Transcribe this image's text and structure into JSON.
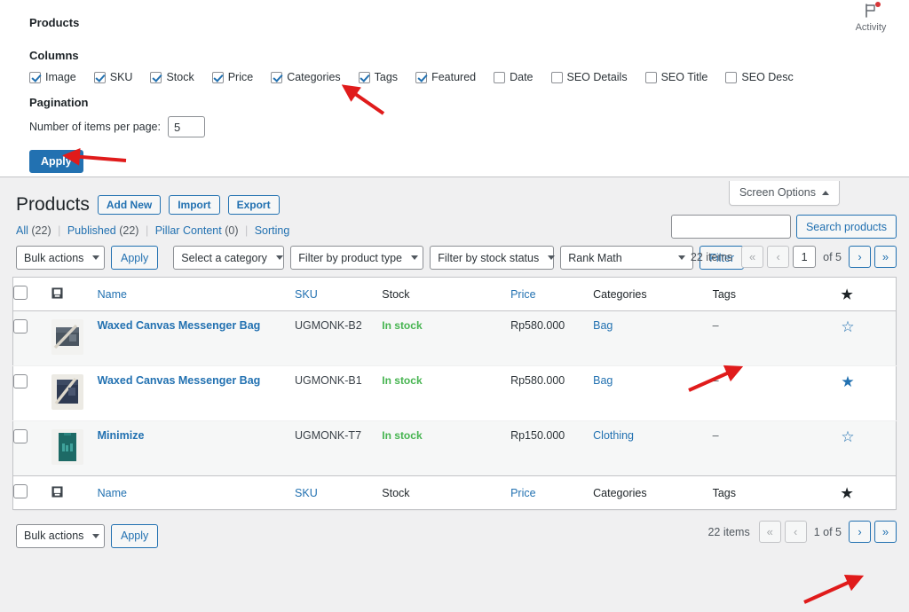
{
  "screen_options": {
    "title": "Products",
    "activity": {
      "label": "Activity",
      "icon": "flag-icon",
      "badge_color": "#d63638"
    },
    "columns_label": "Columns",
    "columns": [
      {
        "label": "Image",
        "checked": true
      },
      {
        "label": "SKU",
        "checked": true
      },
      {
        "label": "Stock",
        "checked": true
      },
      {
        "label": "Price",
        "checked": true
      },
      {
        "label": "Categories",
        "checked": true
      },
      {
        "label": "Tags",
        "checked": true
      },
      {
        "label": "Featured",
        "checked": true
      },
      {
        "label": "Date",
        "checked": false
      },
      {
        "label": "SEO Details",
        "checked": false
      },
      {
        "label": "SEO Title",
        "checked": false
      },
      {
        "label": "SEO Desc",
        "checked": false
      }
    ],
    "pagination_label": "Pagination",
    "items_per_page_label": "Number of items per page:",
    "items_per_page_value": "5",
    "apply_label": "Apply"
  },
  "screen_options_tab": {
    "label": "Screen Options",
    "icon": "caret-up-icon"
  },
  "header": {
    "title": "Products",
    "buttons": [
      {
        "label": "Add New"
      },
      {
        "label": "Import"
      },
      {
        "label": "Export"
      }
    ]
  },
  "search": {
    "value": "",
    "placeholder": "",
    "button_label": "Search products"
  },
  "views": [
    {
      "label": "All",
      "count": "(22)"
    },
    {
      "label": "Published",
      "count": "(22)"
    },
    {
      "label": "Pillar Content",
      "count": "(0)"
    },
    {
      "label": "Sorting",
      "count": ""
    }
  ],
  "toolbar": {
    "bulk_actions": "Bulk actions",
    "apply_label": "Apply",
    "category_filter": "Select a category",
    "product_type_filter": "Filter by product type",
    "stock_status_filter": "Filter by stock status",
    "rank_math_filter": "Rank Math",
    "filter_label": "Filter"
  },
  "pagination": {
    "items_text": "22 items",
    "first": "«",
    "prev": "‹",
    "current_page": "1",
    "of_text": "of 5",
    "next": "›",
    "last": "»",
    "bottom_page_text": "1 of 5"
  },
  "table": {
    "columns": [
      {
        "key": "image",
        "label": "",
        "icon": "image-icon",
        "link": false
      },
      {
        "key": "name",
        "label": "Name",
        "link": true
      },
      {
        "key": "sku",
        "label": "SKU",
        "link": true
      },
      {
        "key": "stock",
        "label": "Stock",
        "link": false
      },
      {
        "key": "price",
        "label": "Price",
        "link": true
      },
      {
        "key": "categories",
        "label": "Categories",
        "link": false
      },
      {
        "key": "tags",
        "label": "Tags",
        "link": false
      },
      {
        "key": "featured",
        "label": "",
        "icon": "star-icon",
        "link": false
      }
    ],
    "rows": [
      {
        "name": "Waxed Canvas Messenger Bag",
        "sku": "UGMONK-B2",
        "stock": "In stock",
        "price": "Rp580.000",
        "categories": "Bag",
        "tags": "–",
        "featured": false,
        "thumb": "bag-thumbnail"
      },
      {
        "name": "Waxed Canvas Messenger Bag",
        "sku": "UGMONK-B1",
        "stock": "In stock",
        "price": "Rp580.000",
        "categories": "Bag",
        "tags": "–",
        "featured": true,
        "thumb": "bag-thumbnail"
      },
      {
        "name": "Minimize",
        "sku": "UGMONK-T7",
        "stock": "In stock",
        "price": "Rp150.000",
        "categories": "Clothing",
        "tags": "–",
        "featured": false,
        "thumb": "tshirt-thumbnail"
      }
    ]
  },
  "colors": {
    "accent": "#2271b1",
    "in_stock": "#46b450",
    "badge": "#d63638",
    "panel_bg": "#ffffff",
    "page_bg": "#f0f0f1"
  }
}
